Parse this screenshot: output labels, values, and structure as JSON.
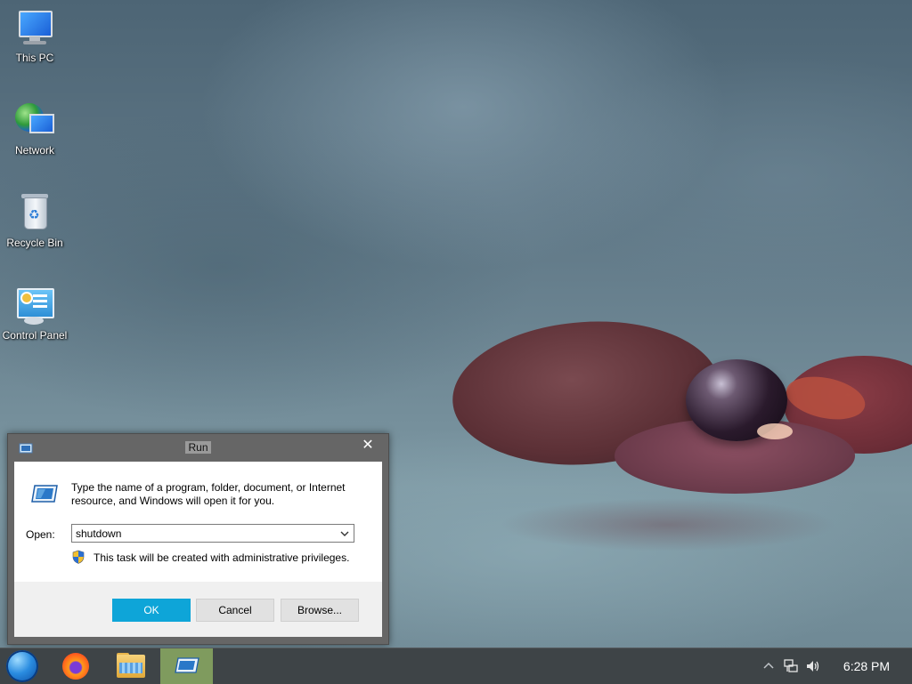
{
  "desktop": {
    "icons": [
      {
        "label": "This PC",
        "icon": "this-pc-icon"
      },
      {
        "label": "Network",
        "icon": "network-icon"
      },
      {
        "label": "Recycle Bin",
        "icon": "recycle-bin-icon"
      },
      {
        "label": "Control Panel",
        "icon": "control-panel-icon"
      }
    ]
  },
  "run_dialog": {
    "title": "Run",
    "close_symbol": "✕",
    "description": "Type the name of a program, folder, document, or Internet resource, and Windows will open it for you.",
    "open_label": "Open:",
    "open_value": "shutdown",
    "admin_note": "This task will be created with administrative privileges.",
    "ok_label": "OK",
    "cancel_label": "Cancel",
    "browse_label": "Browse..."
  },
  "taskbar": {
    "items": [
      {
        "name": "start",
        "icon": "start-orb-icon"
      },
      {
        "name": "firefox",
        "icon": "firefox-icon"
      },
      {
        "name": "file-explorer",
        "icon": "folder-icon"
      },
      {
        "name": "run",
        "icon": "run-icon",
        "active": true
      }
    ],
    "tray": {
      "icons": [
        "chevron-up-icon",
        "network-icon",
        "volume-icon"
      ]
    },
    "clock": "6:28 PM"
  },
  "colors": {
    "ok_button": "#0ea5d8",
    "taskbar": "#3e4447",
    "active_task": "#7f9b5e"
  }
}
